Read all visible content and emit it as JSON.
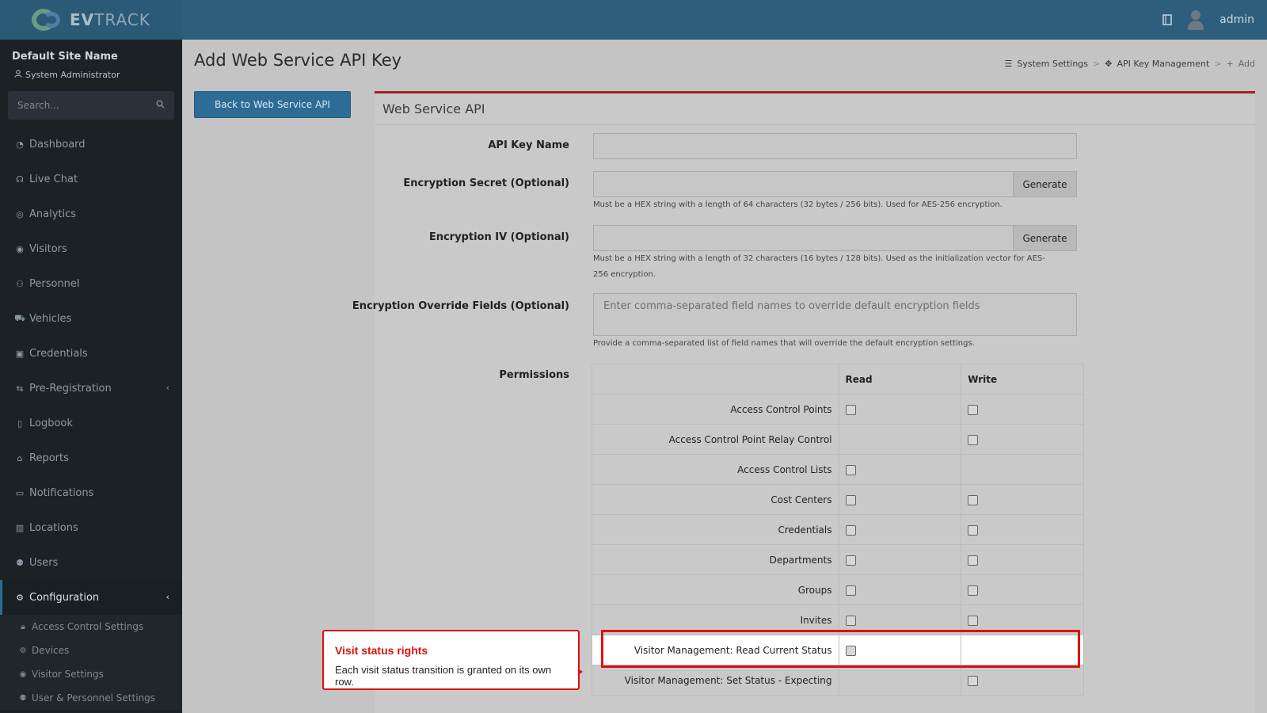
{
  "app": {
    "name": "EVTRACK",
    "user": "admin"
  },
  "sidebar": {
    "site_name": "Default Site Name",
    "role": "System Administrator",
    "search_placeholder": "Search...",
    "items": [
      {
        "label": "Dashboard",
        "icon": "gauge-icon"
      },
      {
        "label": "Live Chat",
        "icon": "headset-icon"
      },
      {
        "label": "Analytics",
        "icon": "target-icon"
      },
      {
        "label": "Visitors",
        "icon": "eye-icon"
      },
      {
        "label": "Personnel",
        "icon": "user-gear-icon"
      },
      {
        "label": "Vehicles",
        "icon": "car-icon"
      },
      {
        "label": "Credentials",
        "icon": "id-card-icon"
      },
      {
        "label": "Pre-Registration",
        "icon": "arrows-icon"
      },
      {
        "label": "Logbook",
        "icon": "book-icon"
      },
      {
        "label": "Reports",
        "icon": "chart-icon"
      },
      {
        "label": "Notifications",
        "icon": "message-icon"
      },
      {
        "label": "Locations",
        "icon": "map-icon"
      },
      {
        "label": "Users",
        "icon": "users-icon"
      },
      {
        "label": "Configuration",
        "icon": "gear-icon"
      }
    ],
    "subitems": [
      {
        "label": "Access Control Settings",
        "icon": "lock-icon"
      },
      {
        "label": "Devices",
        "icon": "devices-icon"
      },
      {
        "label": "Visitor Settings",
        "icon": "eye-icon"
      },
      {
        "label": "User & Personnel Settings",
        "icon": "users-icon"
      }
    ]
  },
  "page": {
    "title": "Add Web Service API Key",
    "back_button": "Back to Web Service API",
    "breadcrumb": [
      "System Settings",
      "API Key Management",
      "Add"
    ]
  },
  "panel": {
    "title": "Web Service API",
    "api_key_name_label": "API Key Name",
    "api_key_name_value": "",
    "secret_label": "Encryption Secret (Optional)",
    "secret_value": "",
    "secret_help": "Must be a HEX string with a length of 64 characters (32 bytes / 256 bits). Used for AES-256 encryption.",
    "iv_label": "Encryption IV (Optional)",
    "iv_value": "",
    "iv_help": "Must be a HEX string with a length of 32 characters (16 bytes / 128 bits). Used as the initialization vector for AES-256 encryption.",
    "override_label": "Encryption Override Fields (Optional)",
    "override_placeholder": "Enter comma-separated field names to override default encryption fields",
    "override_help": "Provide a comma-separated list of field names that will override the default encryption settings.",
    "generate_label": "Generate",
    "permissions_label": "Permissions",
    "read_header": "Read",
    "write_header": "Write",
    "permissions": [
      {
        "name": "Access Control Points",
        "read": true,
        "write": true
      },
      {
        "name": "Access Control Point Relay Control",
        "read": false,
        "write": true
      },
      {
        "name": "Access Control Lists",
        "read": true,
        "write": false
      },
      {
        "name": "Cost Centers",
        "read": true,
        "write": true
      },
      {
        "name": "Credentials",
        "read": true,
        "write": true
      },
      {
        "name": "Departments",
        "read": true,
        "write": true
      },
      {
        "name": "Groups",
        "read": true,
        "write": true
      },
      {
        "name": "Invites",
        "read": true,
        "write": true
      },
      {
        "name": "Visitor Management: Read Current Status",
        "read": true,
        "write": false
      },
      {
        "name": "Visitor Management: Set Status - Expecting",
        "read": false,
        "write": true
      }
    ]
  },
  "callout": {
    "title": "Visit status rights",
    "body": "Each visit status transition is granted on its own row."
  }
}
